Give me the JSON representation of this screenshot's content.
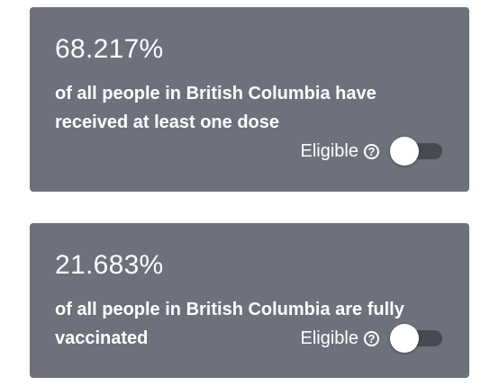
{
  "cards": [
    {
      "percent": "68.217%",
      "description": "of all people in British Columbia have received at least one dose",
      "toggle": {
        "label": "Eligible",
        "help_icon": "question-circle-icon",
        "state": "off"
      }
    },
    {
      "percent": "21.683%",
      "description": "of all people in British Columbia are fully vaccinated",
      "toggle": {
        "label": "Eligible",
        "help_icon": "question-circle-icon",
        "state": "off"
      }
    }
  ],
  "colors": {
    "card_background": "#6c717b",
    "text": "#ffffff",
    "switch_track": "#474a50",
    "switch_thumb": "#ffffff"
  }
}
